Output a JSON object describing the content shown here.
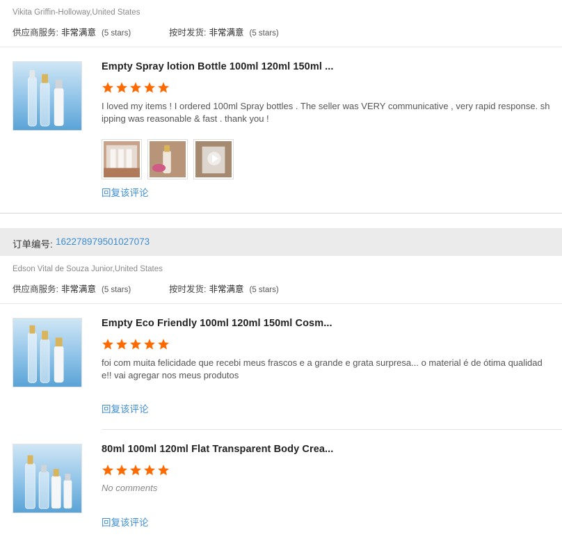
{
  "colors": {
    "star": "#ff6a00",
    "link": "#3d8dd0"
  },
  "block1": {
    "buyer": "Vikita Griffin-Holloway,United States",
    "supplier_label": "供应商服务:",
    "supplier_value": "非常满意",
    "supplier_stars": "(5 stars)",
    "shipping_label": "按时发货:",
    "shipping_value": "非常满意",
    "shipping_stars": "(5 stars)",
    "reviews": [
      {
        "title": "Empty Spray lotion Bottle 100ml 120ml 150ml ...",
        "rating": 5,
        "comment": "I loved my items ! I ordered 100ml Spray bottles . The seller was VERY communicative , very rapid response. shipping was reasonable & fast . thank you !",
        "photos": [
          "review-photo",
          "review-photo",
          "review-video"
        ],
        "reply": "回复该评论"
      }
    ]
  },
  "order2": {
    "label": "订单编号:",
    "number": "162278979501027073"
  },
  "block2": {
    "buyer": "Edson Vital de Souza Junior,United States",
    "supplier_label": "供应商服务:",
    "supplier_value": "非常满意",
    "supplier_stars": "(5 stars)",
    "shipping_label": "按时发货:",
    "shipping_value": "非常满意",
    "shipping_stars": "(5 stars)",
    "reviews": [
      {
        "title": "Empty Eco Friendly 100ml 120ml 150ml Cosm...",
        "rating": 5,
        "comment": "foi com muita felicidade que recebi meus frascos e a grande e grata surpresa... o material é de ótima qualidade!! vai agregar nos meus produtos",
        "reply": "回复该评论"
      },
      {
        "title": "80ml 100ml 120ml Flat Transparent Body Crea...",
        "rating": 5,
        "comment": "No comments",
        "reply": "回复该评论"
      }
    ]
  }
}
